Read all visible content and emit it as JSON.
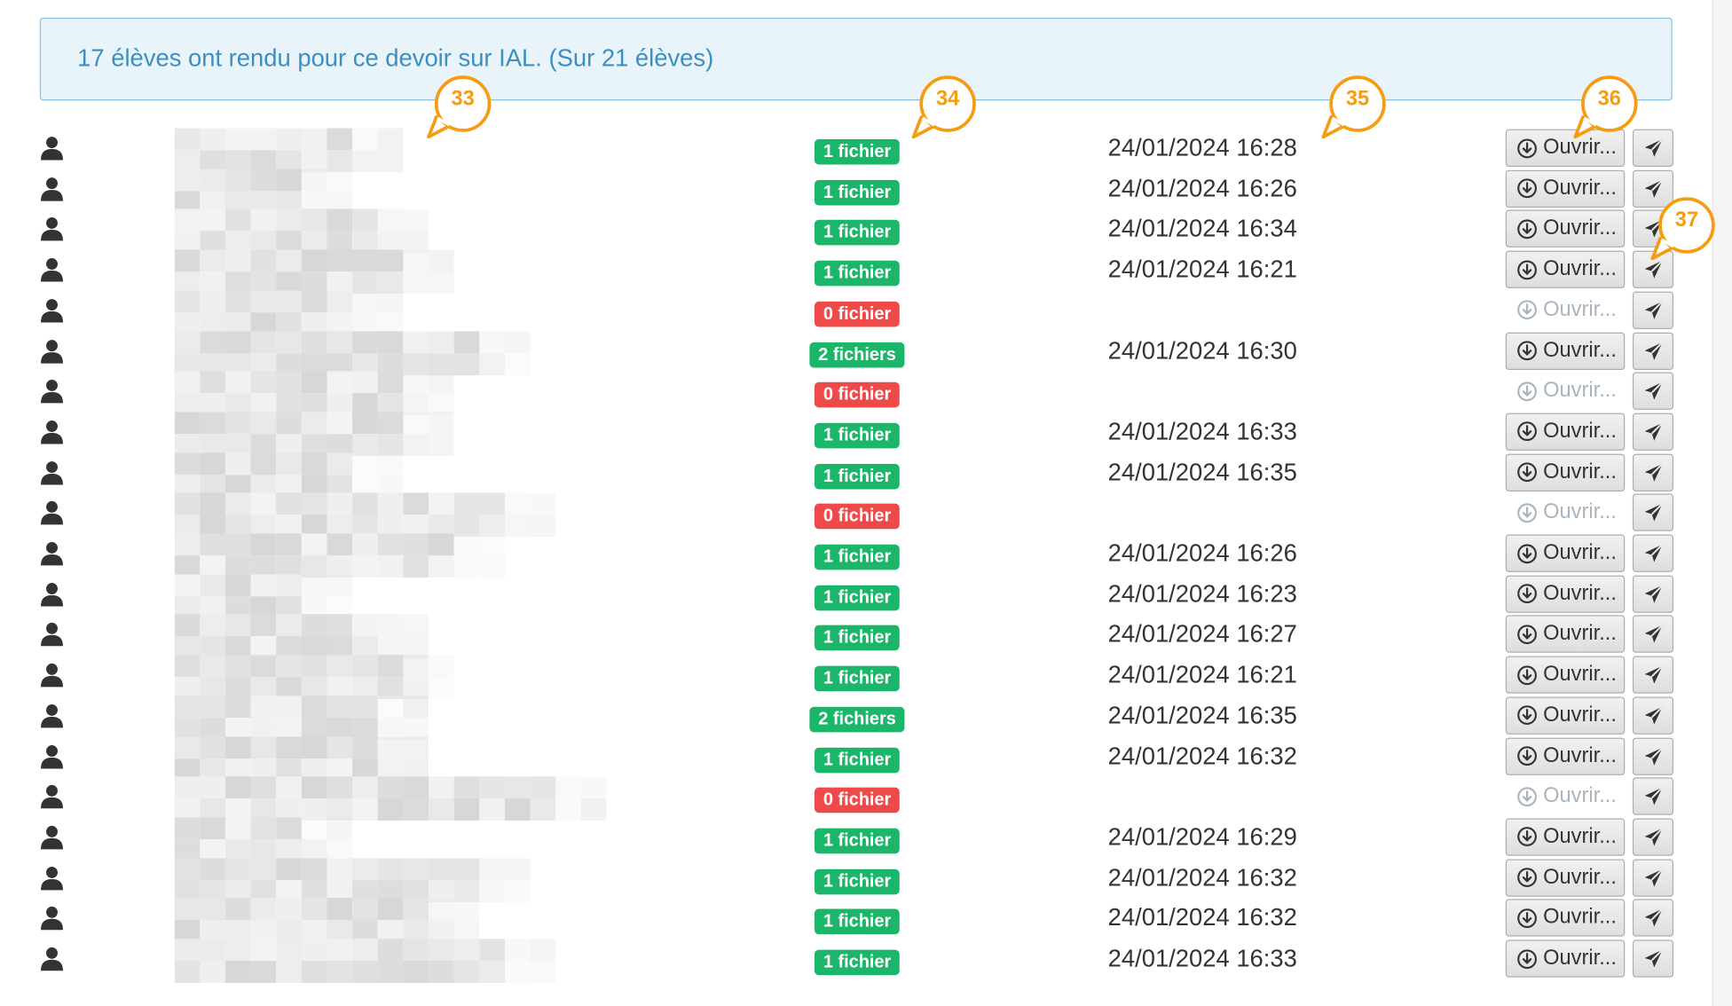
{
  "alert": {
    "text": "17 élèves ont rendu pour ce devoir sur IAL. (Sur 21 élèves)"
  },
  "colors": {
    "green_badge": "#1bb66a",
    "red_badge": "#ef4a4a",
    "callout": "#f59c12",
    "alert_text": "#3d8fbf"
  },
  "icons": {
    "student": "user-silhouette-icon",
    "download": "download-circle-icon",
    "send": "paper-plane-icon"
  },
  "callouts": [
    "33",
    "34",
    "35",
    "36",
    "37"
  ],
  "rows": [
    {
      "files": "1 fichier",
      "status": "ok",
      "date": "24/01/2024 16:28",
      "open": "Ouvrir...",
      "open_enabled": true
    },
    {
      "files": "1 fichier",
      "status": "ok",
      "date": "24/01/2024 16:26",
      "open": "Ouvrir...",
      "open_enabled": true
    },
    {
      "files": "1 fichier",
      "status": "ok",
      "date": "24/01/2024 16:34",
      "open": "Ouvrir...",
      "open_enabled": true
    },
    {
      "files": "1 fichier",
      "status": "ok",
      "date": "24/01/2024 16:21",
      "open": "Ouvrir...",
      "open_enabled": true
    },
    {
      "files": "0 fichier",
      "status": "empty",
      "date": "",
      "open": "Ouvrir...",
      "open_enabled": false
    },
    {
      "files": "2 fichiers",
      "status": "ok",
      "date": "24/01/2024 16:30",
      "open": "Ouvrir...",
      "open_enabled": true
    },
    {
      "files": "0 fichier",
      "status": "empty",
      "date": "",
      "open": "Ouvrir...",
      "open_enabled": false
    },
    {
      "files": "1 fichier",
      "status": "ok",
      "date": "24/01/2024 16:33",
      "open": "Ouvrir...",
      "open_enabled": true
    },
    {
      "files": "1 fichier",
      "status": "ok",
      "date": "24/01/2024 16:35",
      "open": "Ouvrir...",
      "open_enabled": true
    },
    {
      "files": "0 fichier",
      "status": "empty",
      "date": "",
      "open": "Ouvrir...",
      "open_enabled": false
    },
    {
      "files": "1 fichier",
      "status": "ok",
      "date": "24/01/2024 16:26",
      "open": "Ouvrir...",
      "open_enabled": true
    },
    {
      "files": "1 fichier",
      "status": "ok",
      "date": "24/01/2024 16:23",
      "open": "Ouvrir...",
      "open_enabled": true
    },
    {
      "files": "1 fichier",
      "status": "ok",
      "date": "24/01/2024 16:27",
      "open": "Ouvrir...",
      "open_enabled": true
    },
    {
      "files": "1 fichier",
      "status": "ok",
      "date": "24/01/2024 16:21",
      "open": "Ouvrir...",
      "open_enabled": true
    },
    {
      "files": "2 fichiers",
      "status": "ok",
      "date": "24/01/2024 16:35",
      "open": "Ouvrir...",
      "open_enabled": true
    },
    {
      "files": "1 fichier",
      "status": "ok",
      "date": "24/01/2024 16:32",
      "open": "Ouvrir...",
      "open_enabled": true
    },
    {
      "files": "0 fichier",
      "status": "empty",
      "date": "",
      "open": "Ouvrir...",
      "open_enabled": false
    },
    {
      "files": "1 fichier",
      "status": "ok",
      "date": "24/01/2024 16:29",
      "open": "Ouvrir...",
      "open_enabled": true
    },
    {
      "files": "1 fichier",
      "status": "ok",
      "date": "24/01/2024 16:32",
      "open": "Ouvrir...",
      "open_enabled": true
    },
    {
      "files": "1 fichier",
      "status": "ok",
      "date": "24/01/2024 16:32",
      "open": "Ouvrir...",
      "open_enabled": true
    },
    {
      "files": "1 fichier",
      "status": "ok",
      "date": "24/01/2024 16:33",
      "open": "Ouvrir...",
      "open_enabled": true
    }
  ]
}
